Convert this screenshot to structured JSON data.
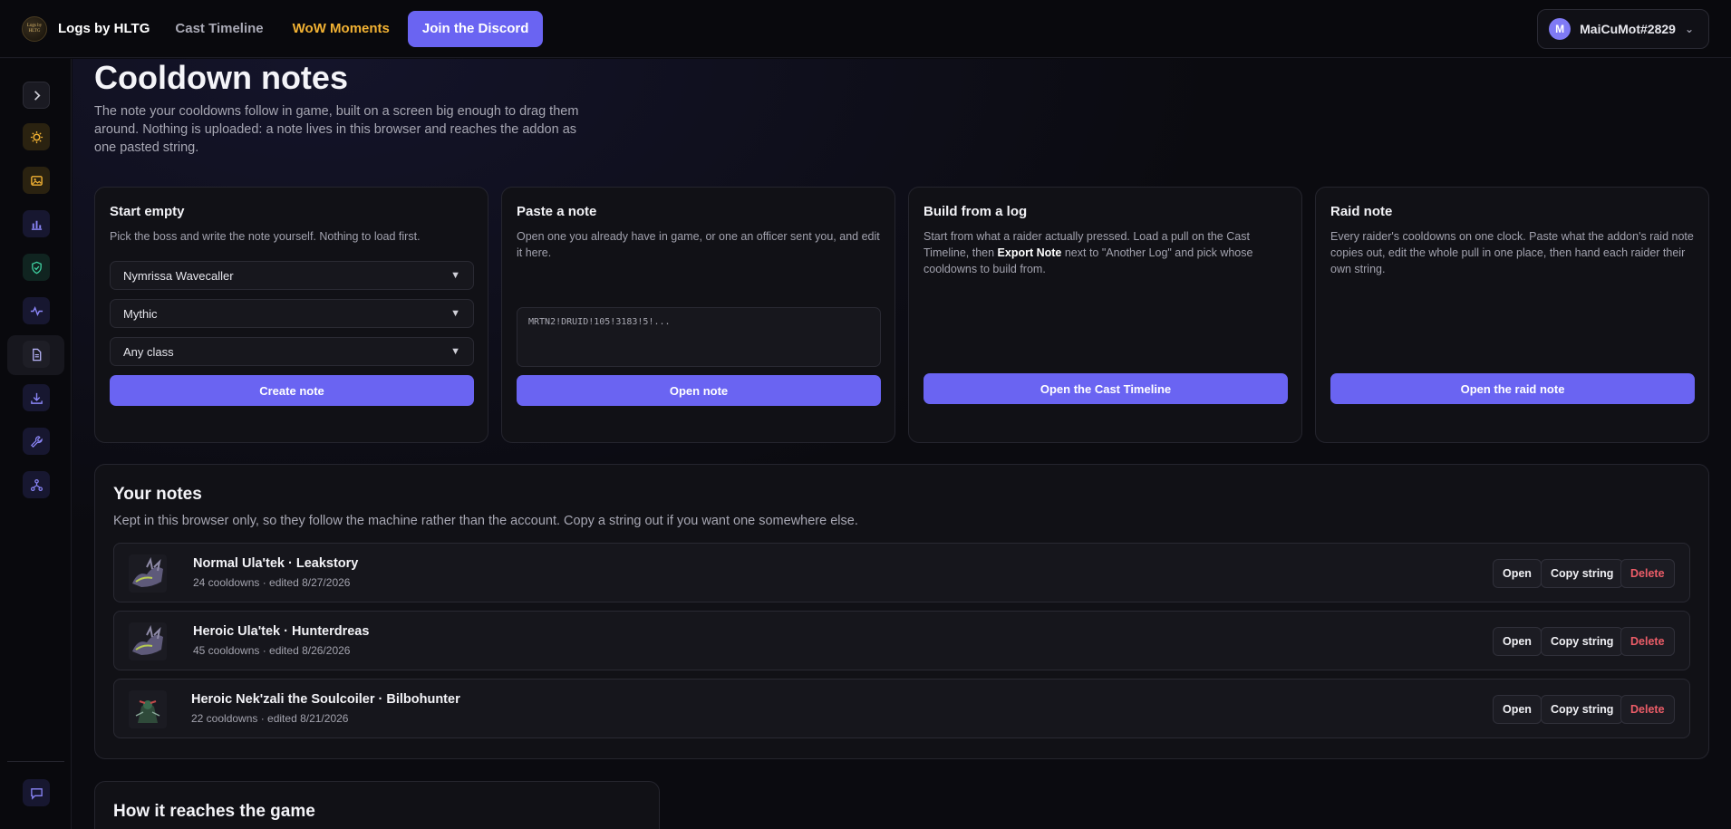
{
  "header": {
    "logo_text": "Logs by HLTG",
    "brand": "Logs by HLTG",
    "nav": [
      "Cast Timeline",
      "WoW Moments"
    ],
    "discord_label": "Join the Discord",
    "user": {
      "initial": "M",
      "name": "MaiCuMot#2829"
    }
  },
  "colors": {
    "accent": "#6a64f2",
    "gold": "#f2b233",
    "danger": "#ec5d68"
  },
  "sidebar": {
    "items": [
      "chevron-right-icon",
      "spark-icon",
      "image-icon",
      "bar-chart-icon",
      "shield-check-icon",
      "pulse-icon",
      "document-icon",
      "download-icon",
      "wrench-icon",
      "hierarchy-icon",
      "chat-icon"
    ],
    "active": "document-icon"
  },
  "page": {
    "title": "Cooldown notes",
    "subtitle": "The note your cooldowns follow in game, built on a screen big enough to drag them around. Nothing is uploaded: a note lives in this browser and reaches the addon as one pasted string."
  },
  "cards": {
    "start": {
      "title": "Start empty",
      "desc": "Pick the boss and write the note yourself. Nothing to load first.",
      "boss": "Nymrissa Wavecaller",
      "difficulty": "Mythic",
      "class": "Any class",
      "button": "Create note"
    },
    "paste": {
      "title": "Paste a note",
      "desc": "Open one you already have in game, or one an officer sent you, and edit it here.",
      "textarea_value": "MRTN2!DRUID!105!3183!5!...",
      "button": "Open note"
    },
    "build": {
      "title": "Build from a log",
      "desc_a": "Start from what a raider actually pressed. Load a pull on the Cast Timeline, then ",
      "desc_bold": "Export Note",
      "desc_b": " next to \"Another Log\" and pick whose cooldowns to build from.",
      "button": "Open the Cast Timeline"
    },
    "raid": {
      "title": "Raid note",
      "desc": "Every raider's cooldowns on one clock. Paste what the addon's raid note copies out, edit the whole pull in one place, then hand each raider their own string.",
      "button": "Open the raid note"
    }
  },
  "notes": {
    "title": "Your notes",
    "desc": "Kept in this browser only, so they follow the machine rather than the account. Copy a string out if you want one somewhere else.",
    "open_label": "Open",
    "copy_label": "Copy string",
    "delete_label": "Delete",
    "rows": [
      {
        "title": "Normal Ula'tek · Leakstory",
        "meta": "24 cooldowns · edited 8/27/2026"
      },
      {
        "title": "Heroic Ula'tek · Hunterdreas",
        "meta": "45 cooldowns · edited 8/26/2026"
      },
      {
        "title": "Heroic Nek'zali the Soulcoiler · Bilbohunter",
        "meta": "22 cooldowns · edited 8/21/2026"
      }
    ]
  },
  "how": {
    "title": "How it reaches the game"
  }
}
